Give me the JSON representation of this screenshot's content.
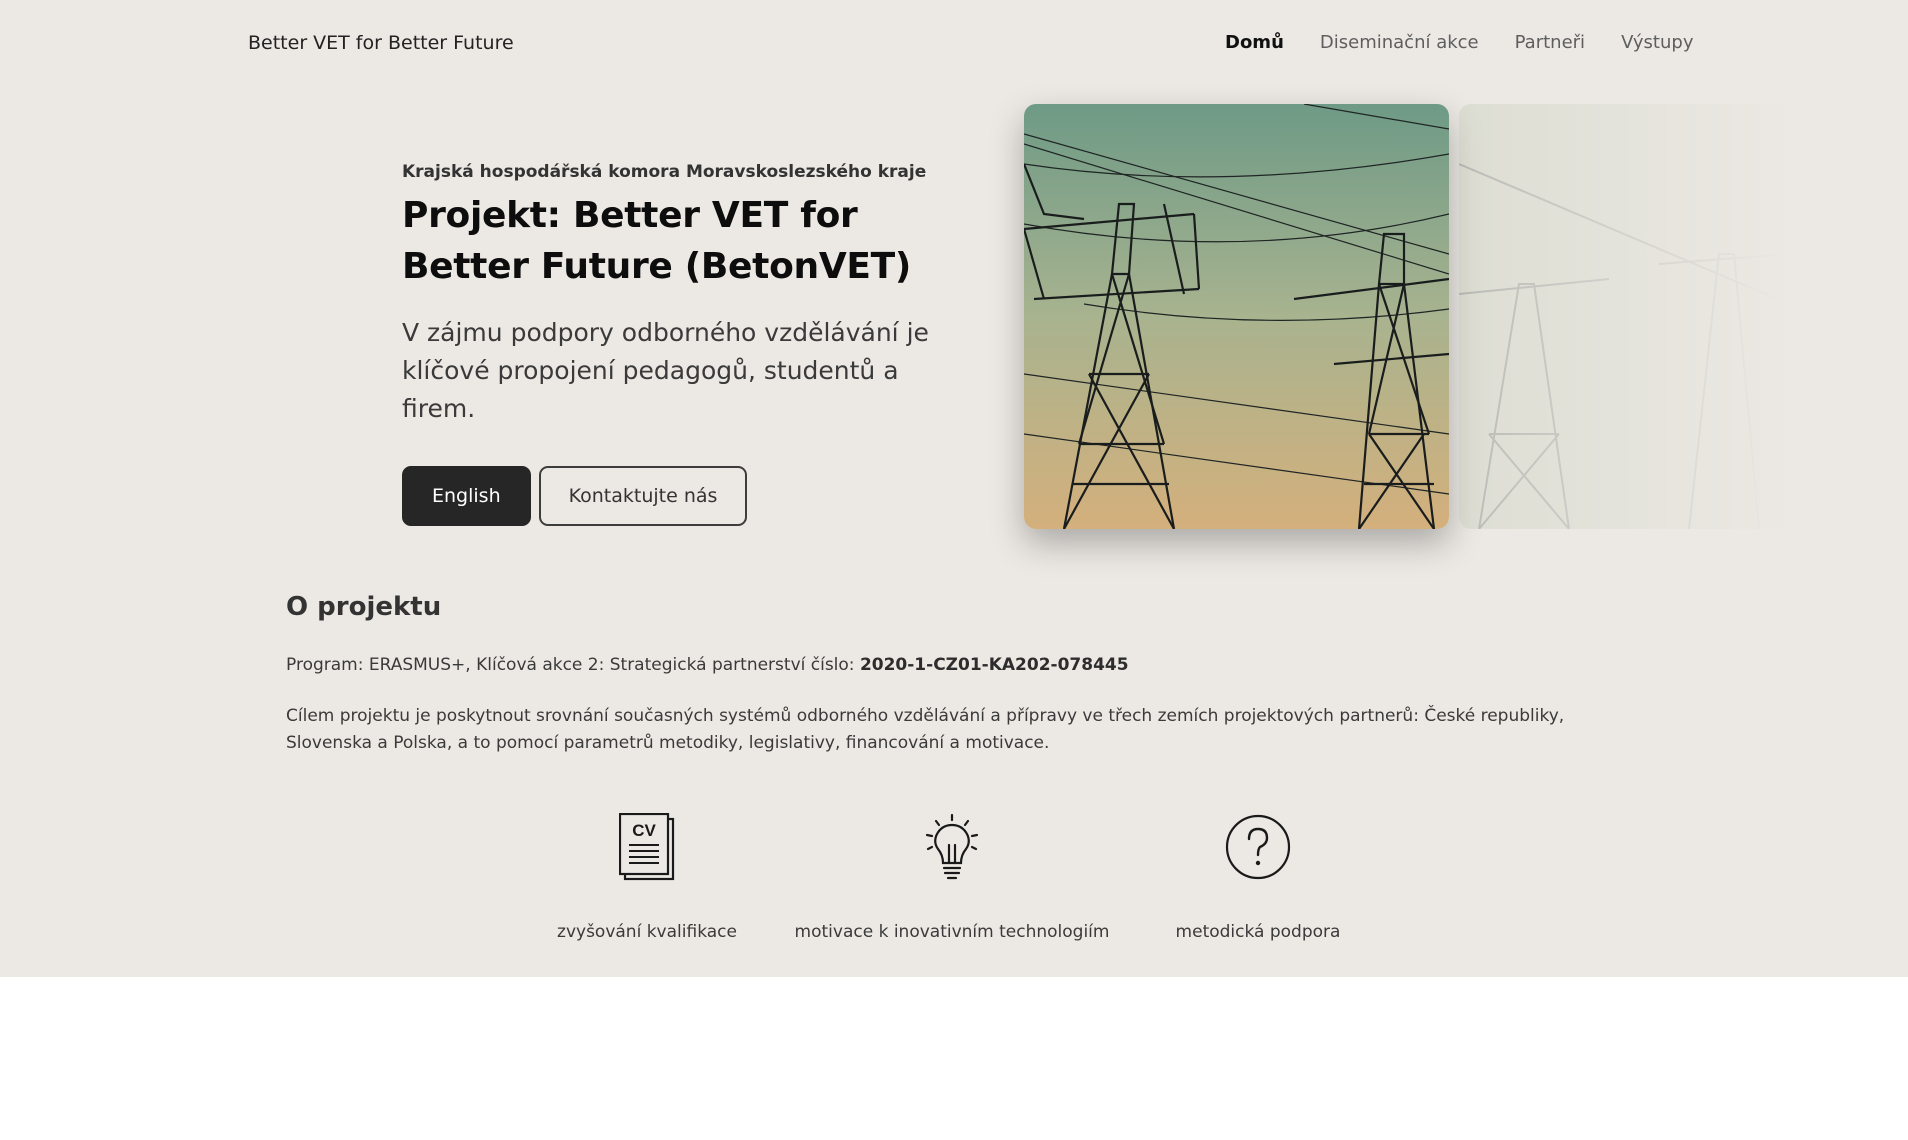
{
  "brand": "Better VET for Better Future",
  "nav": {
    "items": [
      "Domů",
      "Diseminační akce",
      "Partneři",
      "Výstupy"
    ]
  },
  "hero": {
    "org": "Krajská hospodářská komora Moravskoslezského kraje",
    "title": "Projekt: Better VET for Better Future (BetonVET)",
    "lead": "V zájmu podpory odborného vzdělávání je klíčové propojení pedagogů, studentů a firem.",
    "primary_button": "English",
    "secondary_button": "Kontaktujte nás"
  },
  "about": {
    "heading": "O projektu",
    "program_prefix": "Program: ERASMUS+, Klíčová akce 2: Strategická partnerství číslo:",
    "program_number": "2020-1-CZ01-KA202-078445",
    "description": "Cílem projektu je poskytnout srovnání současných systémů odborného vzdělávání a přípravy ve třech zemích projektových partnerů: České republiky, Slovenska a Polska, a to pomocí parametrů metodiky, legislativy, financování a motivace."
  },
  "features": [
    {
      "icon": "cv-document-icon",
      "label": "zvyšování kvalifikace"
    },
    {
      "icon": "lightbulb-icon",
      "label": "motivace k inovativním technologiím"
    },
    {
      "icon": "question-circle-icon",
      "label": "metodická podpora"
    }
  ],
  "colors": {
    "page_bg": "#ece9e4",
    "button_dark": "#262626",
    "text_dark": "#0d0d0d"
  }
}
